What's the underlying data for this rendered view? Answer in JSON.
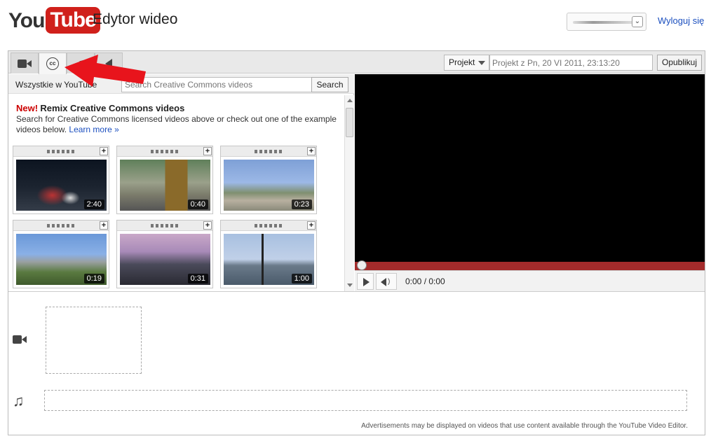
{
  "header": {
    "logo_you": "You",
    "logo_tube": "Tube",
    "title": "Edytor wideo",
    "logout": "Wyloguj się"
  },
  "toolbar": {
    "tabs": [
      "camera-icon",
      "cc-icon",
      "music-note-icon",
      "speaker-icon"
    ],
    "cc_glyph": "cc",
    "note_glyph": "♫",
    "project_label": "Projekt",
    "project_placeholder": "Projekt z Pn, 20 VI 2011, 23:13:20",
    "publish_label": "Opublikuj"
  },
  "browser": {
    "scope": "Wszystkie w YouTube",
    "search_placeholder": "Search Creative Commons videos",
    "search_button": "Search",
    "intro_new": "New!",
    "intro_heading": "Remix Creative Commons videos",
    "intro_text": "Search for Creative Commons licensed videos above or check out one of the example videos below.",
    "intro_link": "Learn more »",
    "videos": [
      {
        "duration": "2:40"
      },
      {
        "duration": "0:40"
      },
      {
        "duration": "0:23"
      },
      {
        "duration": "0:19"
      },
      {
        "duration": "0:31"
      },
      {
        "duration": "1:00"
      }
    ]
  },
  "player": {
    "time": "0:00 / 0:00",
    "progress": 0
  },
  "timeline": {
    "note_glyph": "♫",
    "disclaimer": "Advertisements may be displayed on videos that use content available through the YouTube Video Editor."
  },
  "colors": {
    "brand_red": "#d0201b",
    "link_blue": "#1b4fbf",
    "progress_red": "#a42b2b",
    "annotation_arrow": "#e8141c"
  }
}
